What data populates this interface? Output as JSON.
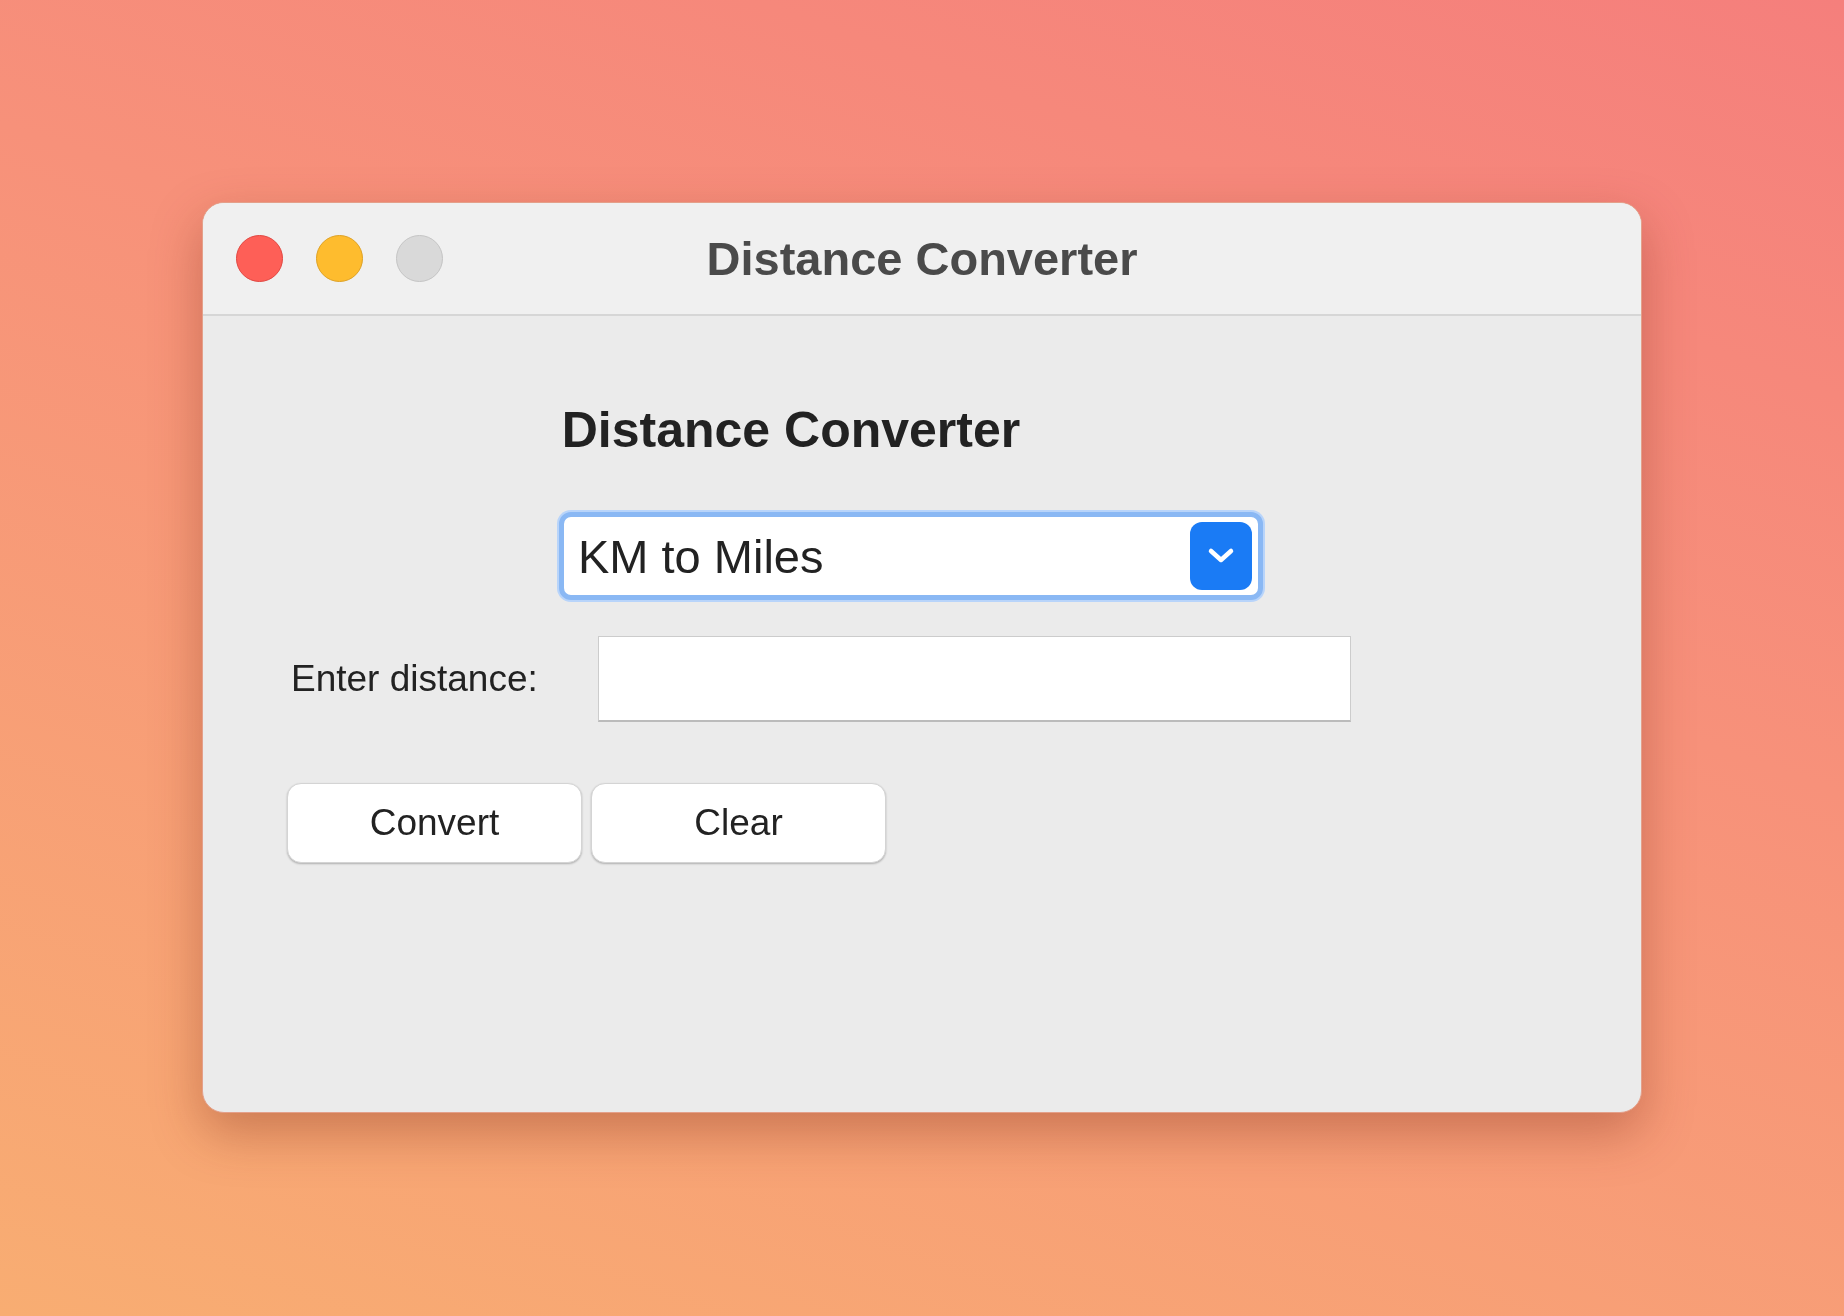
{
  "window": {
    "title": "Distance Converter",
    "controls": [
      {
        "kind": "close",
        "disabled": false
      },
      {
        "kind": "minimize",
        "disabled": false
      },
      {
        "kind": "zoom",
        "disabled": true
      }
    ]
  },
  "heading": "Distance Converter",
  "conversion_dropdown": {
    "value": "KM to Miles",
    "focused": true
  },
  "distance_field": {
    "label": "Enter distance:"
  },
  "buttons": [
    "Convert",
    "Clear"
  ]
}
